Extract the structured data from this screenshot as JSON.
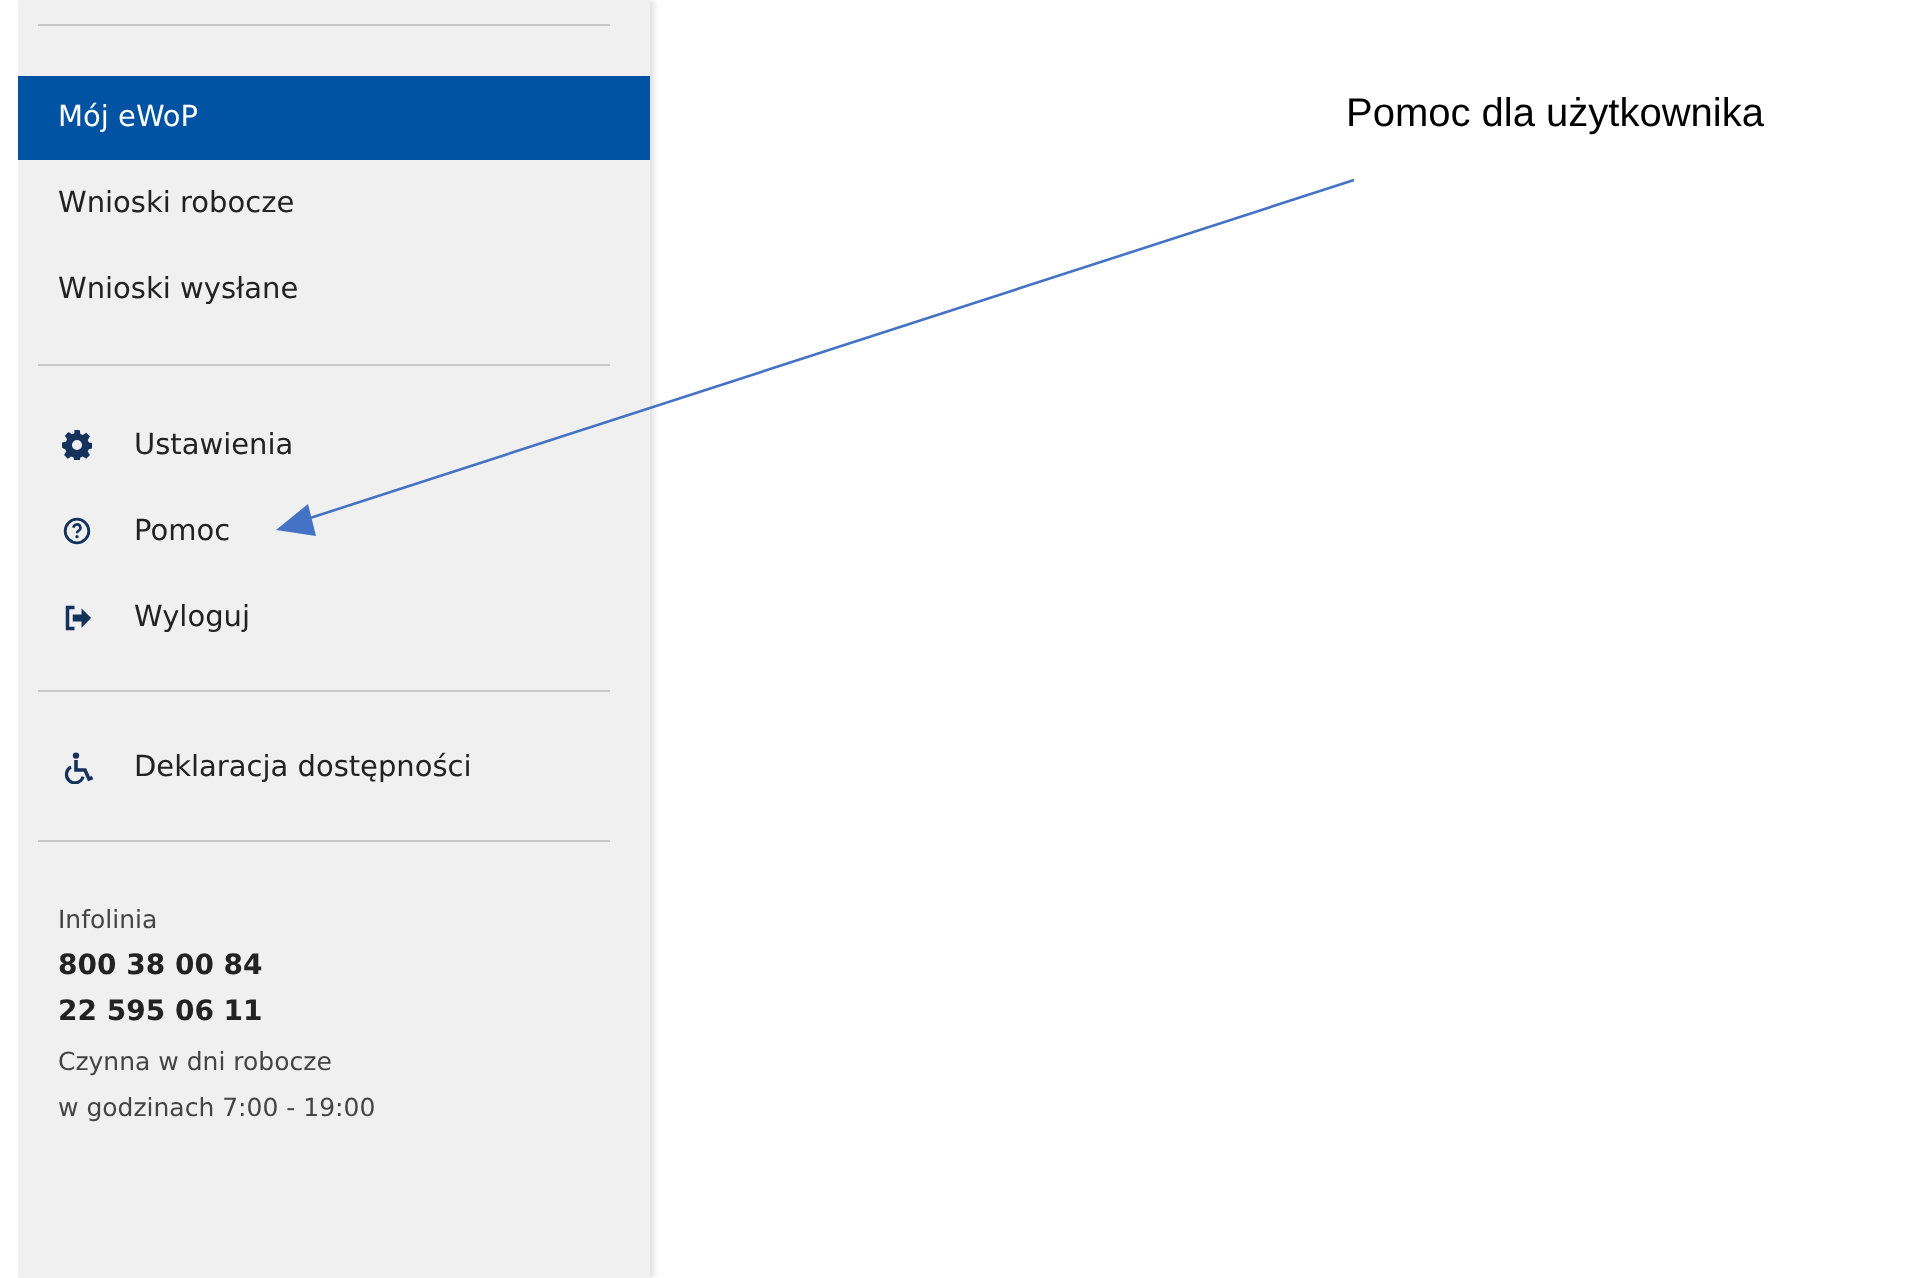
{
  "sidebar": {
    "nav_items": [
      {
        "label": "Mój eWoP",
        "selected": true
      },
      {
        "label": "Wnioski robocze",
        "selected": false
      },
      {
        "label": "Wnioski wysłane",
        "selected": false
      }
    ],
    "account_items": [
      {
        "label": "Ustawienia",
        "kind": "gear"
      },
      {
        "label": "Pomoc",
        "kind": "help"
      },
      {
        "label": "Wyloguj",
        "kind": "logout"
      }
    ],
    "accessibility_item": {
      "label": "Deklaracja dostępności",
      "kind": "wheelchair"
    },
    "infoline": {
      "title": "Infolinia",
      "phones": [
        "800 38 00 84",
        "22 595 06 11"
      ],
      "hours": [
        "Czynna w dni robocze",
        "w godzinach 7:00 - 19:00"
      ]
    }
  },
  "annotation": {
    "text": "Pomoc dla użytkownika"
  }
}
